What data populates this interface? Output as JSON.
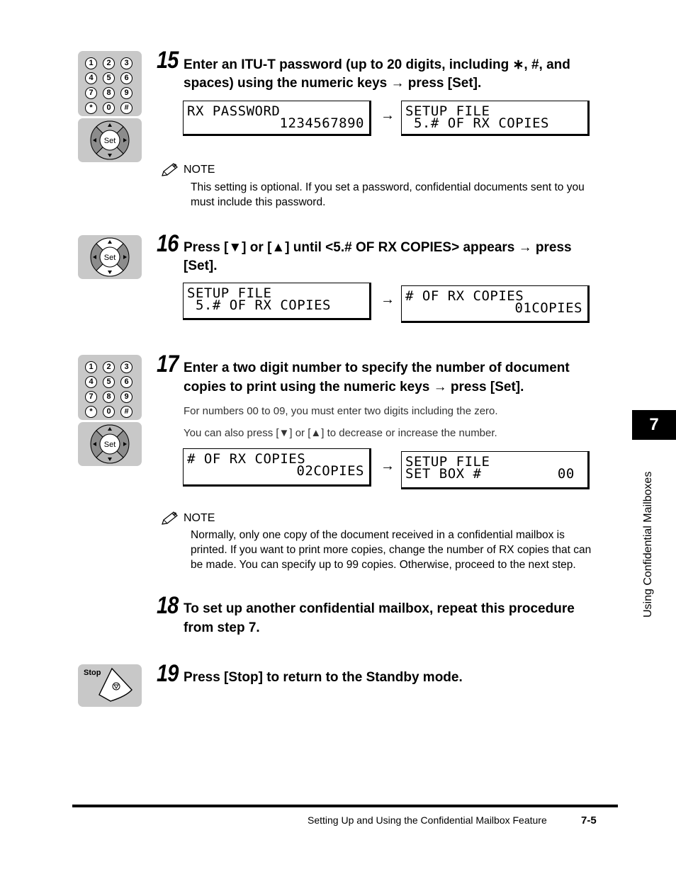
{
  "page": {
    "chapter_tab": "7",
    "chapter_label": "Using Confidential Mailboxes",
    "footer_title": "Setting Up and Using the Confidential Mailbox Feature",
    "page_number": "7-5"
  },
  "keypad": {
    "keys": [
      "1",
      "2",
      "3",
      "4",
      "5",
      "6",
      "7",
      "8",
      "9",
      "*",
      "0",
      "#"
    ],
    "set_label": "Set",
    "stop_label": "Stop"
  },
  "steps": [
    {
      "number": "15",
      "text_line1": "Enter an ITU-T password (up to 20 digits, including ∗, #, and",
      "text_line2": "spaces) using the numeric keys → press [Set].",
      "lcd_before": {
        "line1": "RX PASSWORD",
        "line2": "1234567890"
      },
      "lcd_after": {
        "line1": "SETUP FILE",
        "line2": " 5.# OF RX COPIES"
      },
      "note": {
        "heading": "NOTE",
        "line1": "This setting is optional. If you set a password, confidential documents sent to you",
        "line2": "must include this password."
      }
    },
    {
      "number": "16",
      "text_line1": "Press [▼] or [▲] until <5.# OF RX COPIES> appears → press",
      "text_line2": "[Set].",
      "lcd_before": {
        "line1": "SETUP FILE",
        "line2": " 5.# OF RX COPIES"
      },
      "lcd_after": {
        "line1": "# OF RX COPIES",
        "line2": "01COPIES"
      }
    },
    {
      "number": "17",
      "text_line1": "Enter a two digit number to specify the number of document",
      "text_line2": "copies to print using the numeric keys → press [Set].",
      "body1": "For numbers 00 to 09, you must enter two digits including the zero.",
      "body2": "You can also press [▼] or [▲] to decrease or increase the number.",
      "lcd_before": {
        "line1": "# OF RX COPIES",
        "line2": "02COPIES"
      },
      "lcd_after": {
        "line1": "SETUP FILE",
        "line2": "SET BOX #         00"
      },
      "note": {
        "heading": "NOTE",
        "line1": "Normally, only one copy of the document received in a confidential mailbox is",
        "line2": "printed. If you want to print more copies, change the number of RX copies that can",
        "line3": "be made. You can specify up to 99 copies. Otherwise, proceed to the next step."
      }
    },
    {
      "number": "18",
      "text_line1": "To set up another confidential mailbox, repeat this procedure",
      "text_line2": "from step 7."
    },
    {
      "number": "19",
      "text_line1": "Press [Stop] to return to the Standby mode."
    }
  ],
  "arrow": "→"
}
